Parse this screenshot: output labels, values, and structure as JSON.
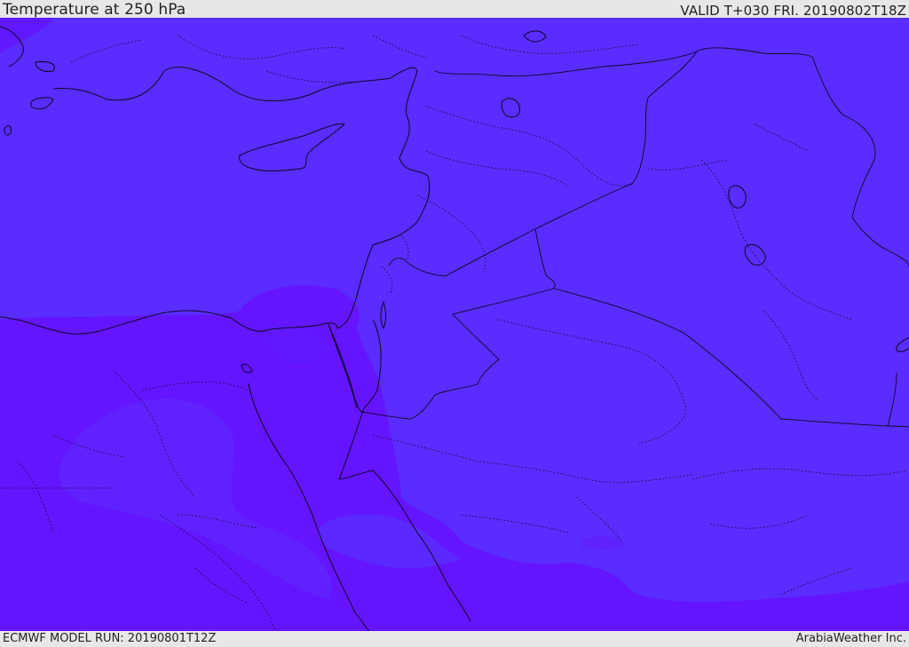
{
  "header": {
    "title": "Temperature at 250 hPa",
    "valid_time": "VALID T+030 FRI. 20190802T18Z"
  },
  "footer": {
    "model_run": "ECMWF MODEL RUN: 20190801T12Z",
    "brand": "ArabiaWeather Inc."
  },
  "colors": {
    "field_primary": "#5a2cff",
    "field_warm_band": "#6514ff",
    "field_mid_band": "#5f22ff",
    "lines": "#0d0820",
    "header_bg": "#e7e7e7"
  }
}
